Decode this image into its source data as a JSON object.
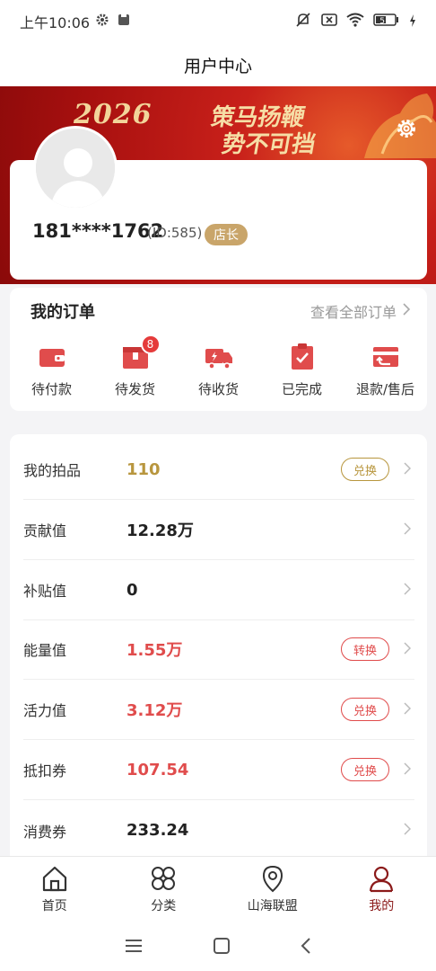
{
  "status_bar": {
    "time": "上午10:06",
    "battery": "51"
  },
  "title": "用户中心",
  "banner": {
    "year": "2026",
    "slogan_line1": "策马扬鞭",
    "slogan_line2": "势不可挡"
  },
  "profile": {
    "phone": "181****1762",
    "id_text": "(ID:585)",
    "role_badge": "店长"
  },
  "orders": {
    "heading": "我的订单",
    "view_all": "查看全部订单",
    "items": [
      {
        "label": "待付款",
        "icon": "wallet-icon"
      },
      {
        "label": "待发货",
        "icon": "package-icon",
        "count": "8"
      },
      {
        "label": "待收货",
        "icon": "truck-icon"
      },
      {
        "label": "已完成",
        "icon": "clipboard-check-icon"
      },
      {
        "label": "退款/售后",
        "icon": "refund-icon"
      }
    ]
  },
  "assets": [
    {
      "name": "我的拍品",
      "value": "110",
      "value_color": "#b8963e",
      "button": "兑换",
      "button_color": "#b8963e"
    },
    {
      "name": "贡献值",
      "value": "12.28万",
      "value_color": "#222222"
    },
    {
      "name": "补贴值",
      "value": "0",
      "value_color": "#222222"
    },
    {
      "name": "能量值",
      "value": "1.55万",
      "value_color": "#e04c4c",
      "button": "转换",
      "button_color": "#e04c4c"
    },
    {
      "name": "活力值",
      "value": "3.12万",
      "value_color": "#e04c4c",
      "button": "兑换",
      "button_color": "#e04c4c"
    },
    {
      "name": "抵扣券",
      "value": "107.54",
      "value_color": "#e04c4c",
      "button": "兑换",
      "button_color": "#e04c4c"
    },
    {
      "name": "消费券",
      "value": "233.24",
      "value_color": "#222222"
    }
  ],
  "bottom_nav": [
    {
      "label": "首页",
      "icon": "home-icon"
    },
    {
      "label": "分类",
      "icon": "grid-icon"
    },
    {
      "label": "山海联盟",
      "icon": "location-pin-icon"
    },
    {
      "label": "我的",
      "icon": "user-icon",
      "active": true
    }
  ],
  "colors": {
    "accent": "#e04c4c",
    "gold": "#b8963e",
    "active_nav": "#8b1a1a",
    "badge": "#c9a56a"
  }
}
